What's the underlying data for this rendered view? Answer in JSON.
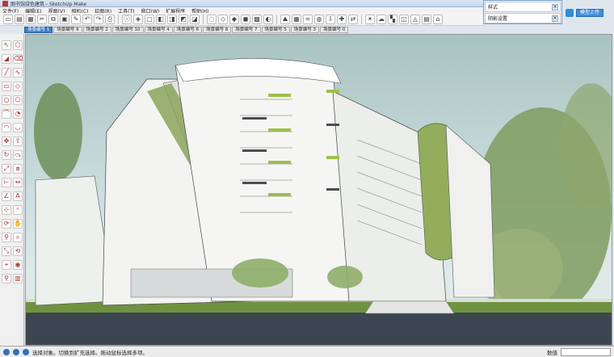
{
  "window": {
    "title": "图书馆绿色建筑 - SketchUp Make"
  },
  "menu": [
    "文件(F)",
    "编辑(E)",
    "视图(V)",
    "相机(C)",
    "绘图(R)",
    "工具(T)",
    "窗口(W)",
    "扩展程序",
    "帮助(H)"
  ],
  "scene_tabs": [
    "场景编号 1",
    "场景编号 9",
    "场景编号 2",
    "场景编号 10",
    "场景编号 4",
    "场景编号 6",
    "场景编号 8",
    "场景编号 7",
    "场景编号 5",
    "场景编号 3",
    "场景编号 0"
  ],
  "active_scene_index": 0,
  "toolbar_icons": [
    "new-icon",
    "open-icon",
    "save-icon",
    "cut-icon",
    "copy-icon",
    "paste-icon",
    "erase-icon",
    "undo-icon",
    "redo-icon",
    "print-icon",
    "model-info-icon",
    "iso-view-icon",
    "top-view-icon",
    "front-view-icon",
    "right-view-icon",
    "back-view-icon",
    "left-view-icon",
    "xray-icon",
    "wireframe-icon",
    "hidden-line-icon",
    "shaded-icon",
    "textured-icon",
    "monochrome-icon",
    "sandbox-from-contours-icon",
    "sandbox-from-scratch-icon",
    "smoove-icon",
    "stamp-icon",
    "drape-icon",
    "add-detail-icon",
    "flip-edge-icon",
    "shadow-icon",
    "fog-icon",
    "edge-style-icon",
    "section-plane-icon",
    "section-display-icon",
    "layer-icon",
    "3d-warehouse-icon"
  ],
  "left_tools": [
    "select-icon",
    "make-component-icon",
    "paint-bucket-icon",
    "eraser-icon",
    "line-icon",
    "freehand-icon",
    "rectangle-icon",
    "rotated-rect-icon",
    "circle-icon",
    "polygon-icon",
    "arc-icon",
    "pie-icon",
    "arc-3pt-icon",
    "arc-2pt-icon",
    "move-icon",
    "push-pull-icon",
    "rotate-icon",
    "follow-me-icon",
    "scale-icon",
    "offset-icon",
    "tape-measure-icon",
    "dimension-icon",
    "protractor-icon",
    "text-icon",
    "axes-icon",
    "3d-text-icon",
    "orbit-icon",
    "pan-icon",
    "zoom-icon",
    "zoom-window-icon",
    "zoom-extents-icon",
    "previous-view-icon",
    "position-camera-icon",
    "look-around-icon",
    "walk-icon",
    "section-icon"
  ],
  "float_panel": {
    "row1": "样式",
    "row2": "阴影设置"
  },
  "upload": {
    "button": "模型上传"
  },
  "status": {
    "text": "选择对象。切换到扩充选择。拖动鼠标选择多项。",
    "measurement_label": "数值"
  },
  "colors": {
    "sky": "#b7cfce",
    "accent_green": "#9dc04a",
    "water": "#3d4650",
    "grass": "#6f9240"
  }
}
